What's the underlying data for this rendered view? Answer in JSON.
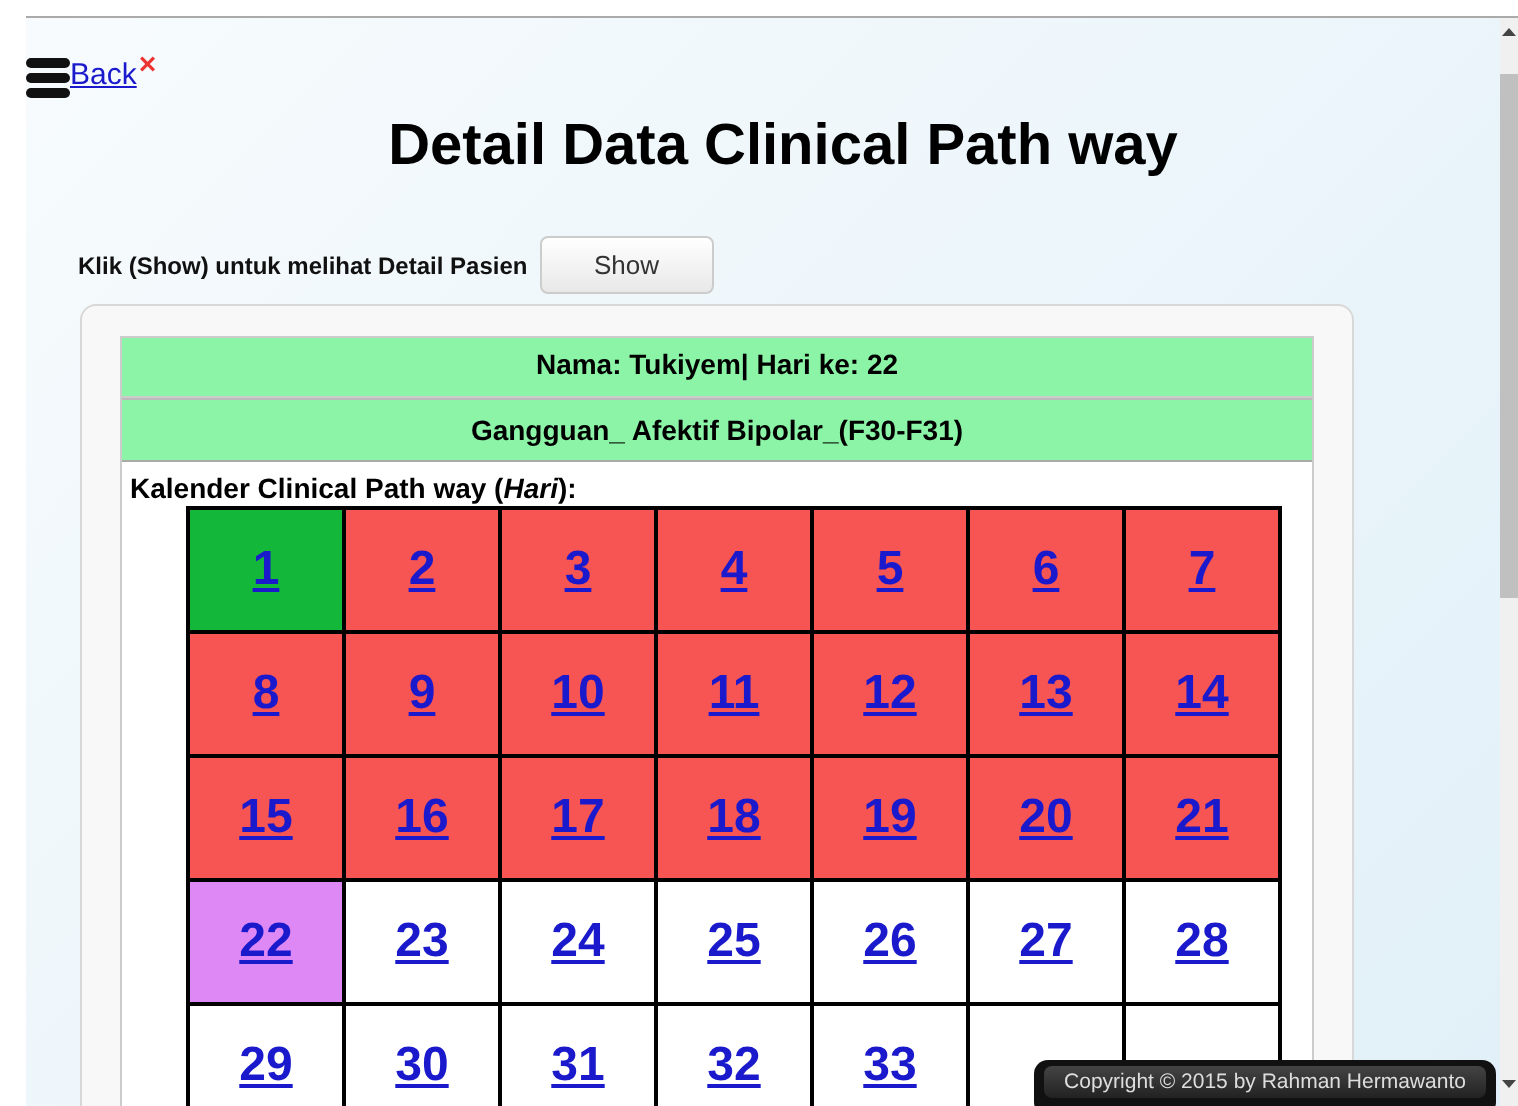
{
  "back_link": "Back",
  "close_mark": "×",
  "title": "Detail Data Clinical Path way",
  "show_prompt": "Klik (Show) untuk melihat Detail Pasien",
  "show_button": "Show",
  "patient_line": "Nama: Tukiyem| Hari ke: 22",
  "diagnosis_line": "Gangguan_ Afektif Bipolar_(F30-F31)",
  "calendar_label": "Kalender Clinical Path way (*Hari*):",
  "days": [
    {
      "label": "1",
      "color": "#13b83a"
    },
    {
      "label": "2",
      "color": "#f75454"
    },
    {
      "label": "3",
      "color": "#f75454"
    },
    {
      "label": "4",
      "color": "#f75454"
    },
    {
      "label": "5",
      "color": "#f75454"
    },
    {
      "label": "6",
      "color": "#f75454"
    },
    {
      "label": "7",
      "color": "#f75454"
    },
    {
      "label": "8",
      "color": "#f75454"
    },
    {
      "label": "9",
      "color": "#f75454"
    },
    {
      "label": "10",
      "color": "#f75454"
    },
    {
      "label": "11",
      "color": "#f75454"
    },
    {
      "label": "12",
      "color": "#f75454"
    },
    {
      "label": "13",
      "color": "#f75454"
    },
    {
      "label": "14",
      "color": "#f75454"
    },
    {
      "label": "15",
      "color": "#f75454"
    },
    {
      "label": "16",
      "color": "#f75454"
    },
    {
      "label": "17",
      "color": "#f75454"
    },
    {
      "label": "18",
      "color": "#f75454"
    },
    {
      "label": "19",
      "color": "#f75454"
    },
    {
      "label": "20",
      "color": "#f75454"
    },
    {
      "label": "21",
      "color": "#f75454"
    },
    {
      "label": "22",
      "color": "#dd88f5"
    },
    {
      "label": "23",
      "color": "#ffffff"
    },
    {
      "label": "24",
      "color": "#ffffff"
    },
    {
      "label": "25",
      "color": "#ffffff"
    },
    {
      "label": "26",
      "color": "#ffffff"
    },
    {
      "label": "27",
      "color": "#ffffff"
    },
    {
      "label": "28",
      "color": "#ffffff"
    },
    {
      "label": "29",
      "color": "#ffffff"
    },
    {
      "label": "30",
      "color": "#ffffff"
    },
    {
      "label": "31",
      "color": "#ffffff"
    },
    {
      "label": "32",
      "color": "#ffffff"
    },
    {
      "label": "33",
      "color": "#ffffff"
    },
    {
      "color": "#ffffff"
    },
    {
      "color": "#ffffff"
    }
  ],
  "footer": "Copyright © 2015 by Rahman Hermawanto"
}
